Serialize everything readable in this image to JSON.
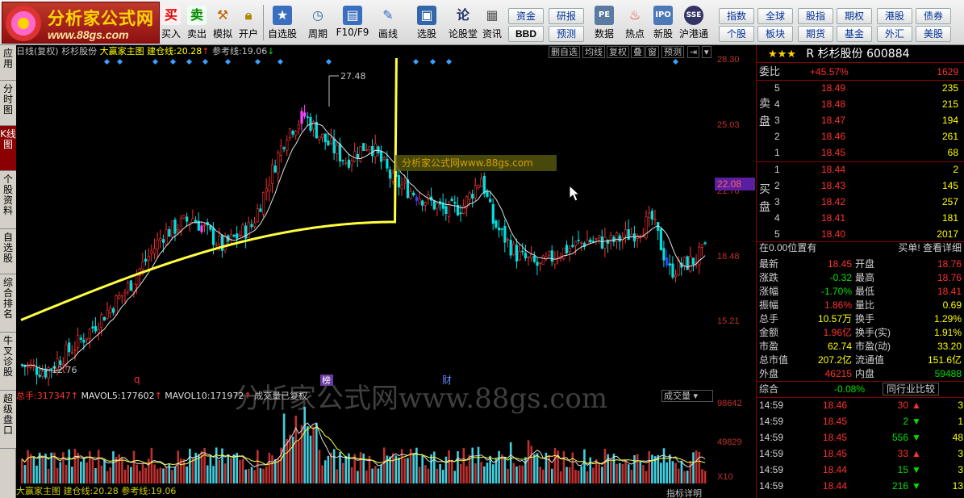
{
  "brand": {
    "name": "分析家公式网",
    "url": "www.88gs.com"
  },
  "toolbar": {
    "buy": "买入",
    "sell": "卖出",
    "simulate": "模拟",
    "open": "开户",
    "watchlist": "自选股",
    "period": "周期",
    "f10": "F10/F9",
    "draw": "画线",
    "select": "选股",
    "forum": "论股堂",
    "info": "资讯",
    "data": "数据",
    "hot": "热点",
    "new": "新股",
    "hk": "沪港通",
    "small": [
      [
        "资金",
        "研报"
      ],
      [
        "BBD",
        "预测"
      ],
      [
        "指数",
        "全球"
      ],
      [
        "个股",
        "板块"
      ],
      [
        "股指",
        "期权"
      ],
      [
        "期货",
        "基金"
      ],
      [
        "港股",
        "债券"
      ],
      [
        "外汇",
        "美股"
      ]
    ]
  },
  "left_tabs": [
    "应用",
    "分时图",
    "K线图",
    "个股资料",
    "自选股",
    "综合排名",
    "牛叉诊股",
    "超级盘口"
  ],
  "chart": {
    "period_label": "日线(复权)",
    "stock_name": "杉杉股份",
    "formula": "大赢家主图",
    "cang_label": "建仓线:",
    "cang_value": "20.28",
    "ref_label": "参考线:",
    "ref_value": "19.06",
    "buttons": [
      "删自选",
      "均线",
      "复权",
      "叠",
      "窗",
      "预测",
      "⇥",
      "▾"
    ],
    "price_high": "27.48",
    "price_low": "12.76",
    "current_price": "22.08",
    "axis": [
      "28.30",
      "25.03",
      "21.76",
      "18.48",
      "15.21"
    ],
    "markers": [
      "q",
      "榜",
      "财"
    ],
    "watermark": "分析家公式网www.88gs.com",
    "inner_watermark": "分析家公式网www.88gs.com"
  },
  "volume": {
    "total_label": "总手:",
    "total": "317347",
    "mavol5_label": "MAVOL5:",
    "mavol5": "177602",
    "mavol10_label": "MAVOL10:",
    "mavol10": "171972",
    "note": "成交量已复权",
    "dropdown": "成交量",
    "axis": [
      "98642",
      "49829",
      "X10"
    ],
    "bottom_text": "大赢家主图 建仓线:20.28 参考线:19.06",
    "indicator_btn": "指标详明"
  },
  "quote": {
    "stars": "★★★",
    "r_flag": "R",
    "name": "杉杉股份",
    "code": "600884",
    "weibi_label": "委比",
    "weibi": "+45.57%",
    "weicha": "1629",
    "sell_label": "卖盘",
    "buy_label": "买盘",
    "sells": [
      [
        "5",
        "18.49",
        "235"
      ],
      [
        "4",
        "18.48",
        "215"
      ],
      [
        "3",
        "18.47",
        "194"
      ],
      [
        "2",
        "18.46",
        "261"
      ],
      [
        "1",
        "18.45",
        "68"
      ]
    ],
    "buys": [
      [
        "1",
        "18.44",
        "2"
      ],
      [
        "2",
        "18.43",
        "145"
      ],
      [
        "3",
        "18.42",
        "257"
      ],
      [
        "4",
        "18.41",
        "181"
      ],
      [
        "5",
        "18.40",
        "2017"
      ]
    ],
    "pos_label": "在0.00位置有",
    "trade_label": "买单! 查看详细",
    "stats": [
      [
        "最新",
        "18.45",
        "开盘",
        "18.76"
      ],
      [
        "涨跌",
        "-0.32",
        "最高",
        "18.76"
      ],
      [
        "涨幅",
        "-1.70%",
        "最低",
        "18.41"
      ],
      [
        "振幅",
        "1.86%",
        "量比",
        "0.69"
      ],
      [
        "总手",
        "10.57万",
        "换手",
        "1.29%"
      ],
      [
        "金额",
        "1.96亿",
        "换手(实)",
        "1.91%"
      ],
      [
        "市盈",
        "62.74",
        "市盈(动)",
        "33.20"
      ],
      [
        "总市值",
        "207.2亿",
        "流通值",
        "151.6亿"
      ],
      [
        "外盘",
        "46215",
        "内盘",
        "59488"
      ]
    ],
    "composite_label": "综合",
    "composite": "-0.08%",
    "compare_btn": "同行业比较",
    "ticks": [
      [
        "14:59",
        "18.46",
        "30",
        "up",
        "3"
      ],
      [
        "14:59",
        "18.45",
        "2",
        "down",
        "1"
      ],
      [
        "14:59",
        "18.45",
        "556",
        "down",
        "48"
      ],
      [
        "14:59",
        "18.45",
        "33",
        "up",
        "3"
      ],
      [
        "14:59",
        "18.44",
        "15",
        "down",
        "3"
      ],
      [
        "14:59",
        "18.44",
        "216",
        "down",
        "13"
      ]
    ]
  },
  "colors": {
    "up": "#ff3030",
    "down": "#00e0e0",
    "ma_yellow": "#ffff40",
    "bg": "#000000"
  }
}
